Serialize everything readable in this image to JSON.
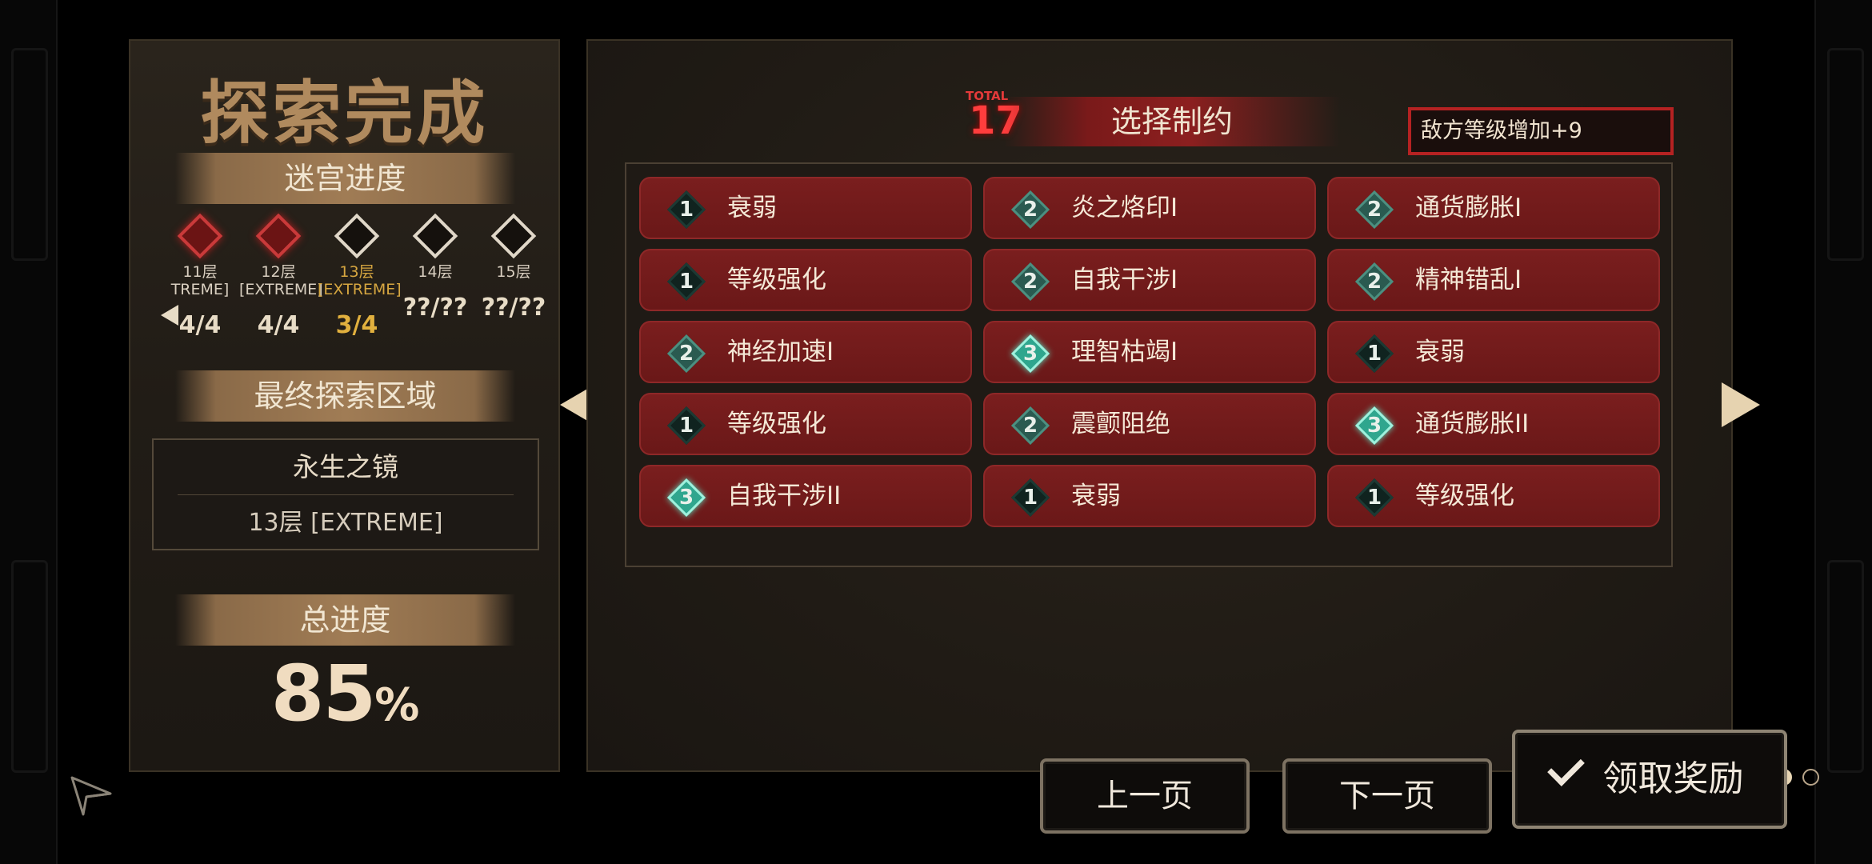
{
  "left": {
    "title": "探索完成",
    "maze_progress_label": "迷宫进度",
    "floors": [
      {
        "name": "11层",
        "difficulty": "TREME]",
        "count": "4/4",
        "state": "done"
      },
      {
        "name": "12层",
        "difficulty": "[EXTREME]",
        "count": "4/4",
        "state": "done"
      },
      {
        "name": "13层",
        "difficulty": "[EXTREME]",
        "count": "3/4",
        "state": "current"
      },
      {
        "name": "14层",
        "difficulty": "",
        "count": "??/??",
        "state": "locked"
      },
      {
        "name": "15层",
        "difficulty": "",
        "count": "??/??",
        "state": "locked"
      }
    ],
    "final_region_label": "最终探索区域",
    "region_name": "永生之镜",
    "region_floor": "13层 [EXTREME]",
    "total_progress_label": "总进度",
    "total_progress_value": "85",
    "total_progress_unit": "%"
  },
  "right": {
    "total_label": "TOTAL",
    "total_value": "17",
    "title": "选择制约",
    "enemy_level_text": "敌方等级增加+9",
    "constraints": [
      {
        "level": "1",
        "name": "衰弱"
      },
      {
        "level": "2",
        "name": "炎之烙印I"
      },
      {
        "level": "2",
        "name": "通货膨胀I"
      },
      {
        "level": "1",
        "name": "等级强化"
      },
      {
        "level": "2",
        "name": "自我干涉I"
      },
      {
        "level": "2",
        "name": "精神错乱I"
      },
      {
        "level": "2",
        "name": "神经加速I"
      },
      {
        "level": "3",
        "name": "理智枯竭I"
      },
      {
        "level": "1",
        "name": "衰弱"
      },
      {
        "level": "1",
        "name": "等级强化"
      },
      {
        "level": "2",
        "name": "震颤阻绝"
      },
      {
        "level": "3",
        "name": "通货膨胀II"
      },
      {
        "level": "3",
        "name": "自我干涉II"
      },
      {
        "level": "1",
        "name": "衰弱"
      },
      {
        "level": "1",
        "name": "等级强化"
      }
    ],
    "page_count": 6,
    "current_page": 5
  },
  "buttons": {
    "prev_page": "上一页",
    "next_page": "下一页",
    "claim": "领取奖励"
  },
  "colors": {
    "accent_red": "#b52222",
    "panel_bg": "#211c16",
    "title_gold": "#b08a5e"
  }
}
